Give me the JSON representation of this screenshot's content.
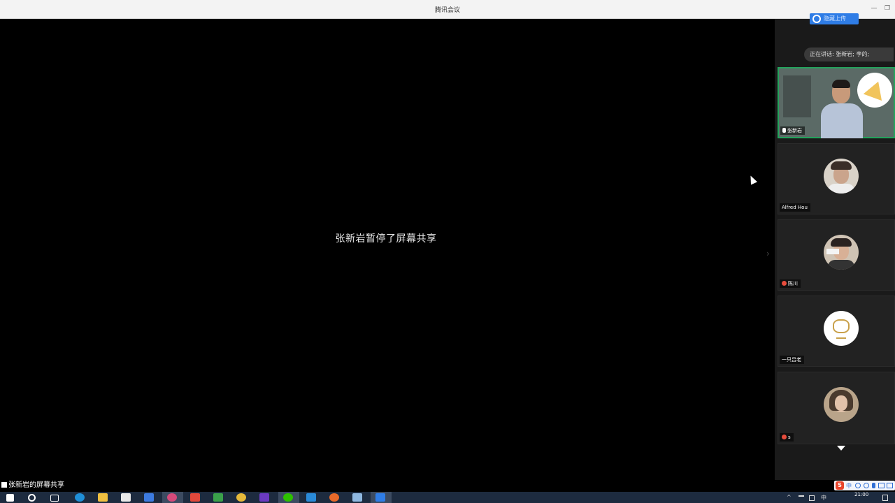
{
  "window": {
    "title": "腾讯会议",
    "minimize_glyph": "—",
    "restore_glyph": "❐"
  },
  "stage": {
    "message": "张新岩暂停了屏幕共享"
  },
  "toolbar": {
    "upload_label": "隐藏上传"
  },
  "speaking": {
    "text": "正在讲话: 张新岩; 李的;"
  },
  "participants": [
    {
      "name": "张新岩",
      "mic": "on",
      "video": true
    },
    {
      "name": "Alfred Hou",
      "mic": "none",
      "video": false
    },
    {
      "name": "陈川",
      "mic": "muted",
      "video": false
    },
    {
      "name": "一只吕老",
      "mic": "none",
      "video": false
    },
    {
      "name": "s",
      "mic": "muted",
      "video": false
    }
  ],
  "share_indicator": {
    "label": "张新岩的屏幕共享"
  },
  "taskbar": {
    "clock": "21:00",
    "tray_lang": "中",
    "ime_glyph": "S"
  },
  "colors": {
    "accent": "#2f7de6",
    "speaking_border": "#23a35c",
    "taskbar": "#1d2b3f"
  }
}
